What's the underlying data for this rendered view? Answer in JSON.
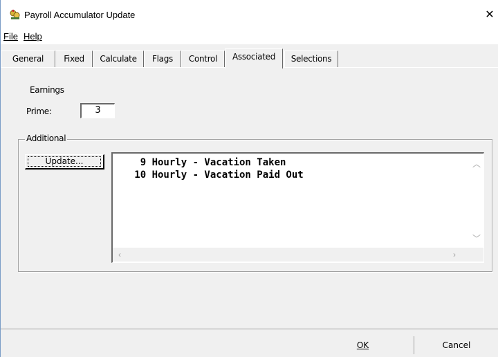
{
  "window": {
    "title": "Payroll Accumulator Update",
    "close_glyph": "✕"
  },
  "menu": {
    "items": [
      {
        "label": "File",
        "hotkey": "F"
      },
      {
        "label": "Help",
        "hotkey": "H"
      }
    ]
  },
  "tabs": [
    {
      "label": "General"
    },
    {
      "label": "Fixed"
    },
    {
      "label": "Calculate"
    },
    {
      "label": "Flags"
    },
    {
      "label": "Control"
    },
    {
      "label": "Associated",
      "active": true
    },
    {
      "label": "Selections"
    }
  ],
  "earnings": {
    "heading": "Earnings",
    "prime_label": "Prime:",
    "prime_value": "3"
  },
  "additional": {
    "legend": "Additional",
    "update_button": "Update...",
    "list_rows": [
      "    9 Hourly - Vacation Taken",
      "   10 Hourly - Vacation Paid Out"
    ]
  },
  "footer": {
    "ok_label": "OK",
    "cancel_label": "Cancel"
  },
  "icons": {
    "app_icon": "payroll-app-icon",
    "close": "close-icon",
    "scroll_up": "chevron-up-icon",
    "scroll_down": "chevron-down-icon",
    "scroll_left": "chevron-left-icon",
    "scroll_right": "chevron-right-icon"
  }
}
